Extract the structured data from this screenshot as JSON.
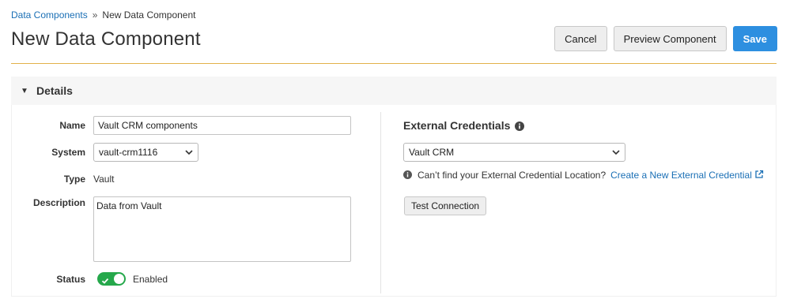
{
  "breadcrumb": {
    "parent": "Data Components",
    "separator": "»",
    "current": "New Data Component"
  },
  "header": {
    "title": "New Data Component",
    "cancel_label": "Cancel",
    "preview_label": "Preview Component",
    "save_label": "Save"
  },
  "section": {
    "title": "Details",
    "expanded": true
  },
  "form": {
    "name_label": "Name",
    "name_value": "Vault CRM components",
    "system_label": "System",
    "system_value": "vault-crm1116",
    "type_label": "Type",
    "type_value": "Vault",
    "description_label": "Description",
    "description_value": "Data from Vault",
    "status_label": "Status",
    "status_value": "Enabled",
    "status_on": true
  },
  "external": {
    "title": "External Credentials",
    "selected": "Vault CRM",
    "hint_text": "Can’t find your External Credential Location?",
    "create_link": "Create a New External Credential",
    "test_label": "Test Connection"
  },
  "colors": {
    "accent_rule": "#e2b14a",
    "primary": "#2d8fe0",
    "link": "#1a6fb5",
    "toggle_on": "#25a84b"
  }
}
